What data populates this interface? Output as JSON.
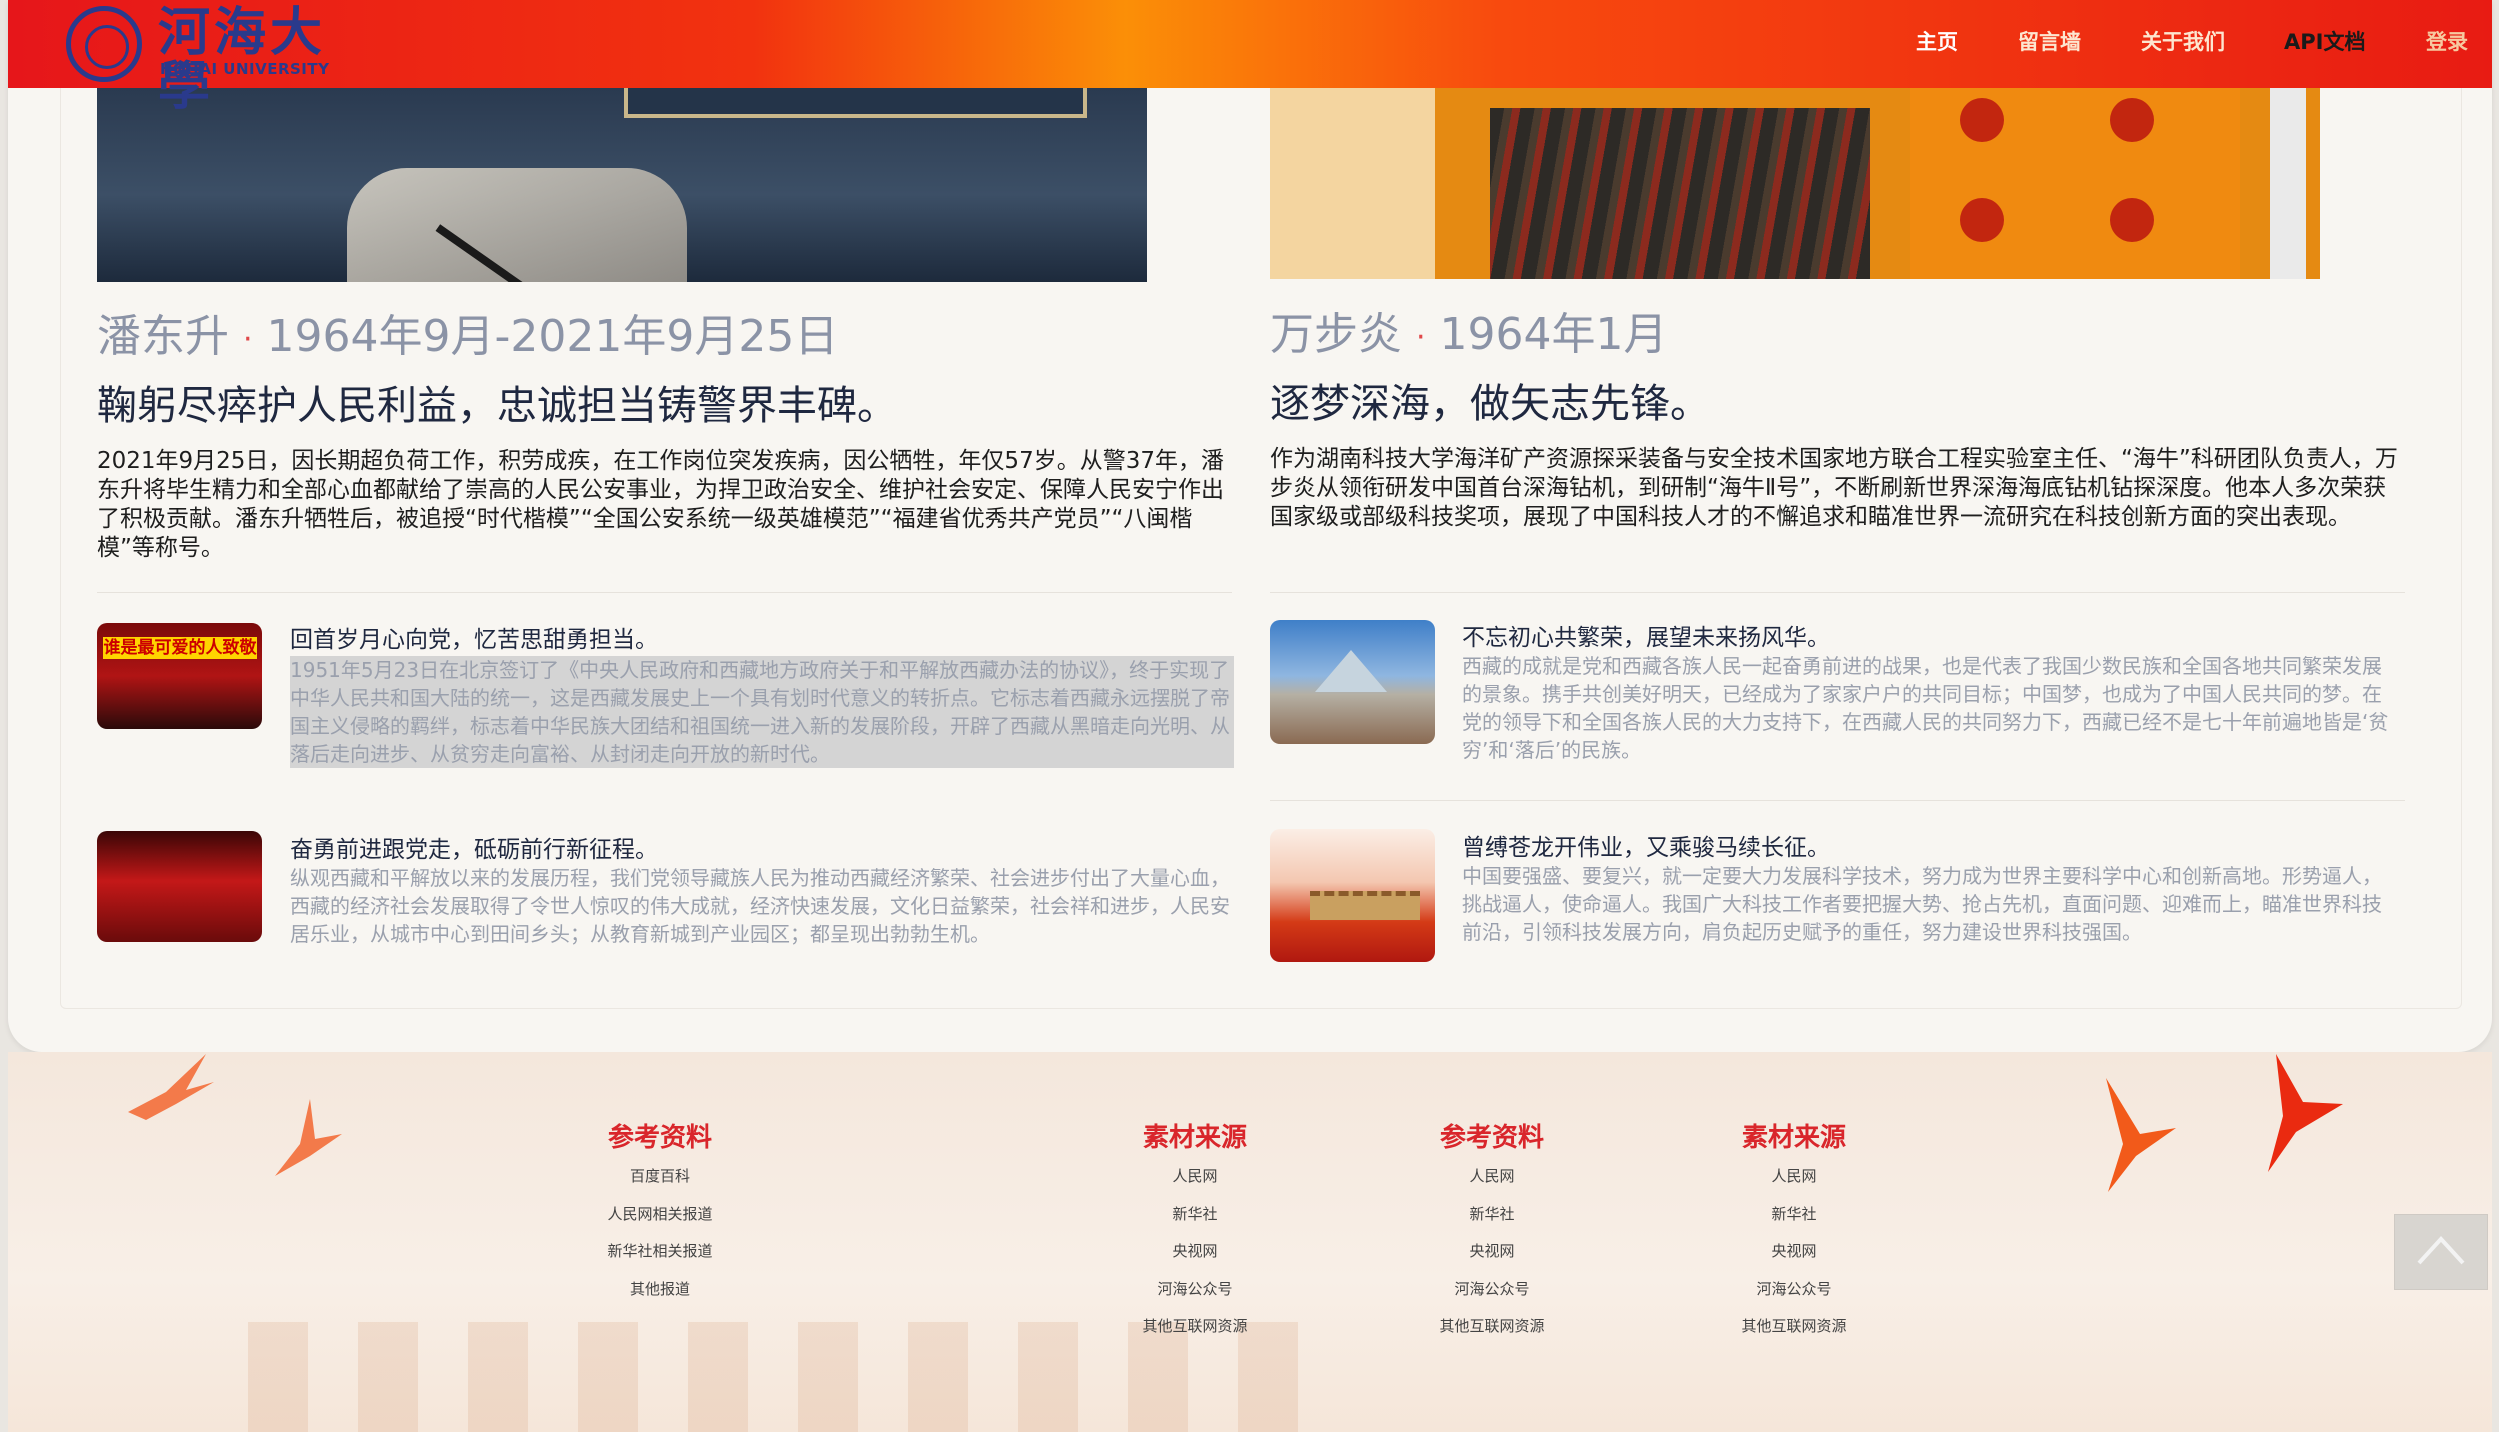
{
  "header": {
    "logo_cn": "河海大學",
    "logo_en": "HOHAI UNIVERSITY",
    "nav": [
      "主页",
      "留言墙",
      "关于我们",
      "API文档",
      "登录"
    ]
  },
  "articles": [
    {
      "name": "潘东升",
      "dates": "1964年9月-2021年9月25日",
      "headline": "鞠躬尽瘁护人民利益，忠诚担当铸警界丰碑。",
      "body": "2021年9月25日，因长期超负荷工作，积劳成疾，在工作岗位突发疾病，因公牺牲，年仅57岁。从警37年，潘东升将毕生精力和全部心血都献给了崇高的人民公安事业，为捍卫政治安全、维护社会安定、保障人民安宁作出了积极贡献。潘东升牺牲后，被追授“时代楷模”“全国公安系统一级英雄模范”“福建省优秀共产党员”“八闽楷模”等称号。"
    },
    {
      "name": "万步炎",
      "dates": "1964年1月",
      "headline": "逐梦深海，做矢志先锋。",
      "body": "作为湖南科技大学海洋矿产资源探采装备与安全技术国家地方联合工程实验室主任、“海牛”科研团队负责人，万步炎从领衔研发中国首台深海钻机，到研制“海牛Ⅱ号”，不断刷新世界深海海底钻机钻探深度。他本人多次荣获国家级或部级科技奖项，展现了中国科技人才的不懈追求和瞄准世界一流研究在科技创新方面的突出表现。"
    }
  ],
  "items": [
    {
      "title": "回首岁月心向党，忆苦思甜勇担当。",
      "desc": "1951年5月23日在北京签订了《中央人民政府和西藏地方政府关于和平解放西藏办法的协议》，终于实现了中华人民共和国大陆的统一，这是西藏发展史上一个具有划时代意义的转折点。它标志着西藏永远摆脱了帝国主义侵略的羁绊，标志着中华民族大团结和祖国统一进入新的发展阶段，开辟了西藏从黑暗走向光明、从落后走向进步、从贫穷走向富裕、从封闭走向开放的新时代。",
      "thumb_caption": "谁是最可爱的人致敬"
    },
    {
      "title": "不忘初心共繁荣，展望未来扬风华。",
      "desc": "西藏的成就是党和西藏各族人民一起奋勇前进的战果，也是代表了我国少数民族和全国各地共同繁荣发展的景象。携手共创美好明天，已经成为了家家户户的共同目标；中国梦，也成为了中国人民共同的梦。在党的领导下和全国各族人民的大力支持下，在西藏人民的共同努力下，西藏已经不是七十年前遍地皆是‘贫穷’和‘落后’的民族。"
    },
    {
      "title": "奋勇前进跟党走，砥砺前行新征程。",
      "desc": "纵观西藏和平解放以来的发展历程，我们党领导藏族人民为推动西藏经济繁荣、社会进步付出了大量心血，西藏的经济社会发展取得了令世人惊叹的伟大成就，经济快速发展，文化日益繁荣，社会祥和进步，人民安居乐业，从城市中心到田间乡头；从教育新城到产业园区；都呈现出勃勃生机。"
    },
    {
      "title": "曾缚苍龙开伟业，又乘骏马续长征。",
      "desc": "中国要强盛、要复兴，就一定要大力发展科学技术，努力成为世界主要科学中心和创新高地。形势逼人，挑战逼人，使命逼人。我国广大科技工作者要把握大势、抢占先机，直面问题、迎难而上，瞄准世界科技前沿，引领科技发展方向，肩负起历史赋予的重任，努力建设世界科技强国。"
    }
  ],
  "footer": {
    "columns": [
      {
        "title": "参考资料",
        "links": [
          "百度百科",
          "人民网相关报道",
          "新华社相关报道",
          "其他报道"
        ]
      },
      {
        "title": "素材来源",
        "links": [
          "人民网",
          "新华社",
          "央视网",
          "河海公众号",
          "其他互联网资源"
        ]
      },
      {
        "title": "参考资料",
        "links": [
          "人民网",
          "新华社",
          "央视网",
          "河海公众号",
          "其他互联网资源"
        ]
      },
      {
        "title": "素材来源",
        "links": [
          "人民网",
          "新华社",
          "央视网",
          "河海公众号",
          "其他互联网资源"
        ]
      }
    ]
  },
  "icons": {
    "back_to_top": "chevron-up-icon",
    "bird": "bird-silhouette-icon",
    "logo": "university-seal-icon"
  },
  "colors": {
    "header_start": "#e6161a",
    "header_mid": "#fb8f07",
    "footer_title": "#d9262b",
    "name_gray": "#8b93a6",
    "headline": "#1f2840"
  }
}
